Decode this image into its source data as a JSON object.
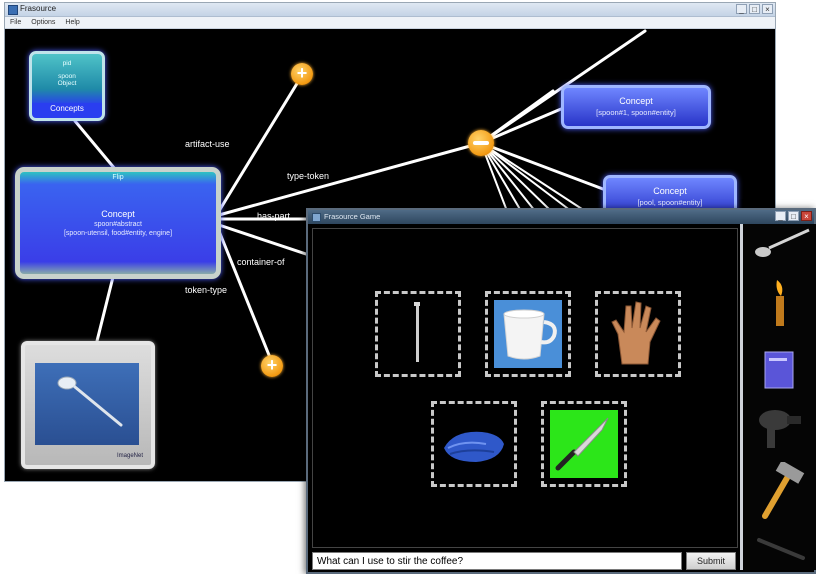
{
  "back_window": {
    "title": "Frasource",
    "menu": [
      "File",
      "Options",
      "Help"
    ],
    "nodes": {
      "concepts": {
        "line1": "pid",
        "line2": "spoon",
        "line3": "Object",
        "footer": "Concepts"
      },
      "main": {
        "top": "Flip",
        "head": "Concept",
        "sub1": "spoon#abstract",
        "sub2": "[spoon-utensil, food#entity, engine]"
      },
      "image": {
        "caption": "ImageNet"
      },
      "concept_a": {
        "head": "Concept",
        "sub": "[spoon#1, spoon#entity]"
      },
      "concept_b": {
        "head": "Concept",
        "sub": "[pool, spoon#entity]"
      }
    },
    "edge_labels": {
      "artifact_use": "artifact-use",
      "type_token": "type-token",
      "has_part": "has-part",
      "container_of": "container-of",
      "token_type": "token-type"
    }
  },
  "front_window": {
    "title": "Frasource Game",
    "answer_text": "What can I use to stir the coffee?",
    "submit_label": "Submit",
    "slots": [
      {
        "item": "nail",
        "bg": ""
      },
      {
        "item": "cup",
        "bg": "#4a8fd8"
      },
      {
        "item": "hand",
        "bg": ""
      },
      {
        "item": "towel",
        "bg": ""
      },
      {
        "item": "knife",
        "bg": "#2ce619"
      }
    ],
    "side_items": [
      "spoon",
      "torch",
      "book",
      "hair-dryer",
      "hammer",
      "pen"
    ]
  },
  "colors": {
    "accent_orange": "#f39a12",
    "node_blue": "#3a3ee8",
    "highlight_green": "#2ce619",
    "highlight_blue": "#4a8fd8"
  }
}
